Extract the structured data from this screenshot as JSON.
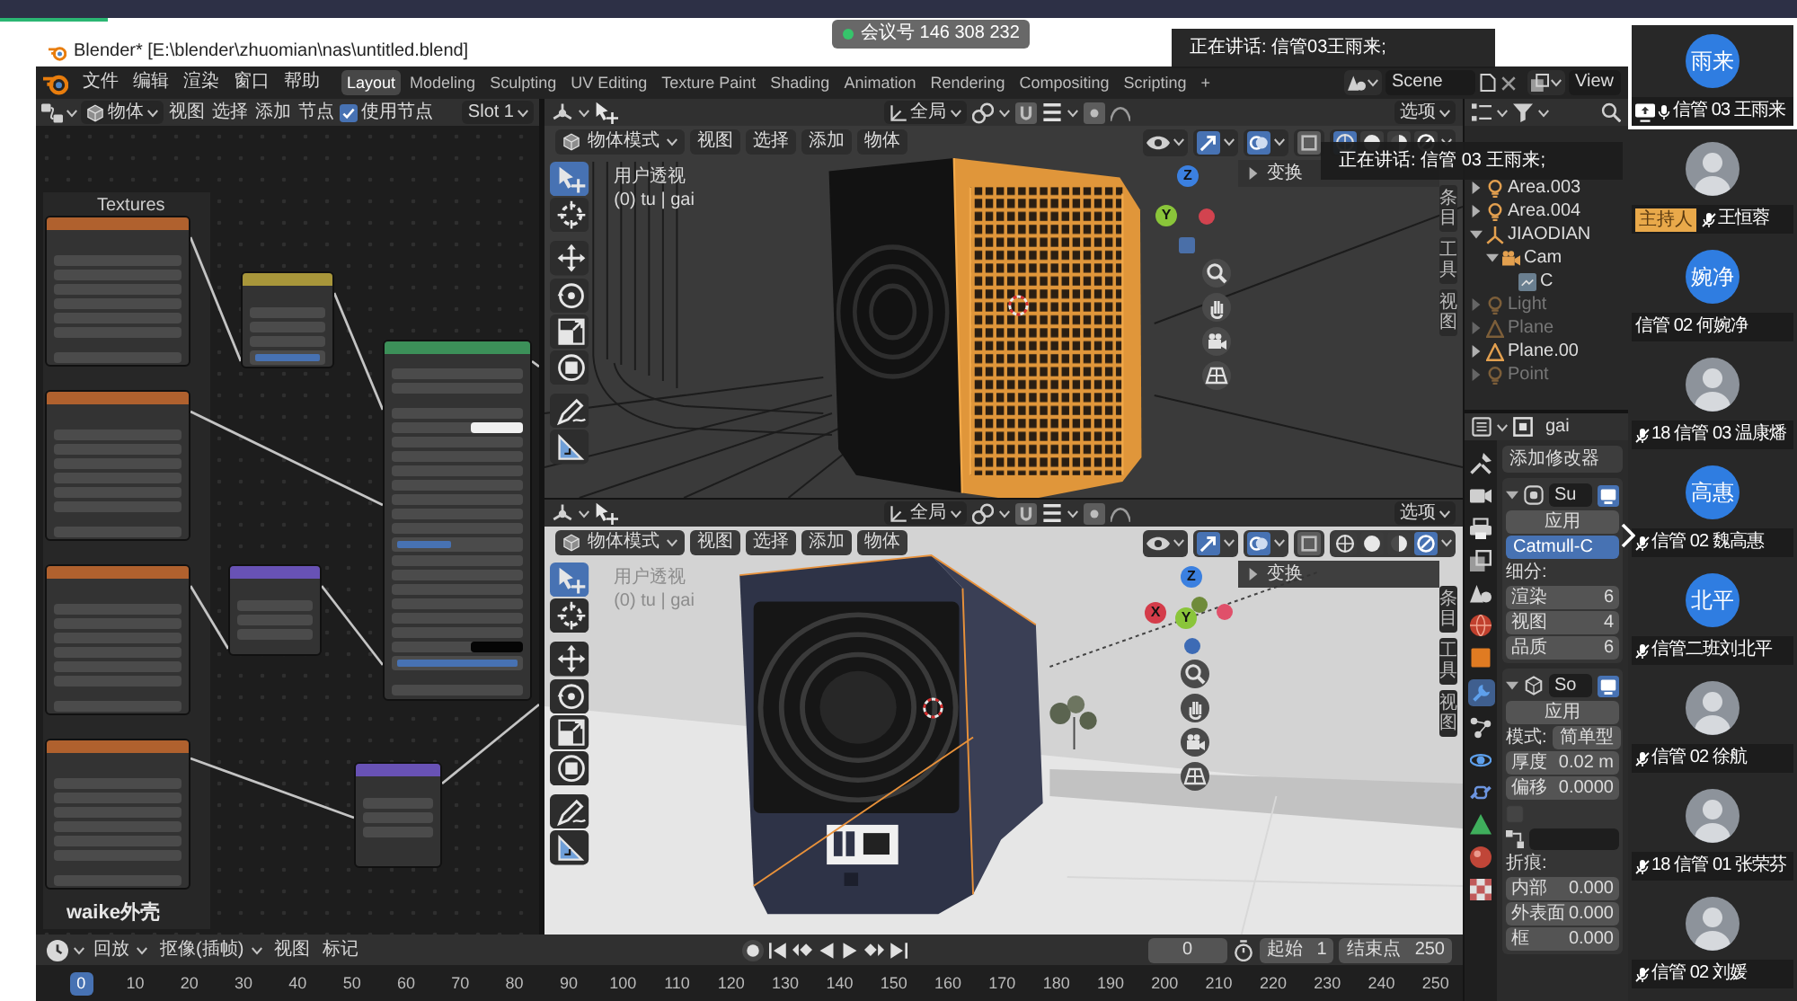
{
  "meeting": {
    "number": "会议号 146 308 232",
    "toasts": [
      {
        "text": "正在讲话: 信管03王雨来;"
      },
      {
        "text": "正在讲话: 信管 03 王雨来;"
      }
    ]
  },
  "window": {
    "title": "Blender* [E:\\blender\\zhuomian\\nas\\untitled.blend]"
  },
  "topbar": {
    "menus": [
      "文件",
      "编辑",
      "渲染",
      "窗口",
      "帮助"
    ],
    "workspaces": [
      {
        "label": "Layout",
        "selected": true
      },
      {
        "label": "Modeling",
        "selected": false
      },
      {
        "label": "Sculpting",
        "selected": false
      },
      {
        "label": "UV Editing",
        "selected": false
      },
      {
        "label": "Texture Paint",
        "selected": false
      },
      {
        "label": "Shading",
        "selected": false
      },
      {
        "label": "Animation",
        "selected": false
      },
      {
        "label": "Rendering",
        "selected": false
      },
      {
        "label": "Compositing",
        "selected": false
      },
      {
        "label": "Scripting",
        "selected": false
      }
    ],
    "add_workspace": "+",
    "scene": "Scene",
    "view_layer": "View"
  },
  "node_editor": {
    "object_menu": "物体",
    "menus": [
      "视图",
      "选择",
      "添加",
      "节点"
    ],
    "use_nodes": {
      "label": "使用节点",
      "checked": true
    },
    "slot": "Slot 1",
    "frame": {
      "label": "Textures",
      "footer": "waike外壳"
    },
    "nodes": [
      {
        "kind": "image",
        "color": "#b0612e"
      },
      {
        "kind": "image",
        "color": "#b0612e"
      },
      {
        "kind": "image",
        "color": "#b0612e"
      },
      {
        "kind": "image",
        "color": "#b0612e"
      },
      {
        "kind": "converter",
        "color": "#a8963a",
        "sliders": [
          {
            "level": 1
          }
        ]
      },
      {
        "kind": "bsdf",
        "color": "#3c9059",
        "sliders": [
          {
            "level": 0.45
          },
          {
            "level": 1
          }
        ],
        "swatches": [
          {
            "color": "#f0f0f0"
          },
          {
            "color": "#050505"
          }
        ]
      },
      {
        "kind": "vector",
        "color": "#6852b5"
      },
      {
        "kind": "vector",
        "color": "#6852b5"
      }
    ]
  },
  "viewports": [
    {
      "kind": "wireframe",
      "orientation": "全局",
      "options": "选项",
      "mode": "物体模式",
      "menus": [
        "视图",
        "选择",
        "添加",
        "物体"
      ],
      "view_name": "用户透视",
      "collection": "(0) tu | gai",
      "transform": "变换",
      "tools": [
        {
          "kind": "select",
          "selected": true
        },
        {
          "kind": "cursor",
          "selected": false
        },
        {
          "kind": "move",
          "selected": false
        },
        {
          "kind": "rotate",
          "selected": false
        },
        {
          "kind": "scale",
          "selected": false
        },
        {
          "kind": "transform",
          "selected": false
        },
        {
          "kind": "annotate",
          "selected": false
        },
        {
          "kind": "measure",
          "selected": false
        }
      ],
      "gizmo": [
        {
          "label": "Z",
          "color": "#3b80e0"
        },
        {
          "label": "Y",
          "color": "#8ac53a"
        }
      ],
      "side_tabs": [
        {
          "label": "条目"
        },
        {
          "label": "工具"
        },
        {
          "label": "视图"
        }
      ]
    },
    {
      "kind": "rendered",
      "orientation": "全局",
      "options": "选项",
      "mode": "物体模式",
      "menus": [
        "视图",
        "选择",
        "添加",
        "物体"
      ],
      "view_name": "用户透视",
      "collection": "(0) tu | gai",
      "transform": "变换",
      "tools": [
        {
          "kind": "select",
          "selected": true
        },
        {
          "kind": "cursor",
          "selected": false
        },
        {
          "kind": "move",
          "selected": false
        },
        {
          "kind": "rotate",
          "selected": false
        },
        {
          "kind": "scale",
          "selected": false
        },
        {
          "kind": "transform",
          "selected": false
        },
        {
          "kind": "annotate",
          "selected": false
        },
        {
          "kind": "measure",
          "selected": false
        }
      ],
      "gizmo": [
        {
          "label": "Z",
          "color": "#3b80e0"
        },
        {
          "label": "X",
          "color": "#d43c4a"
        },
        {
          "label": "Y",
          "color": "#8ac53a"
        }
      ],
      "side_tabs": [
        {
          "label": "条目"
        },
        {
          "label": "工具"
        },
        {
          "label": "视图"
        }
      ]
    }
  ],
  "outliner": {
    "items": [
      {
        "label": "Area.003",
        "kind": "light",
        "hidden": false,
        "expanded": false
      },
      {
        "label": "Area.004",
        "kind": "light",
        "hidden": false,
        "expanded": false
      },
      {
        "label": "JIAODIAN",
        "kind": "empty",
        "hidden": false,
        "expanded": true,
        "children": [
          {
            "label": "Cam",
            "kind": "camera",
            "hidden": false,
            "expanded": true,
            "children": [
              {
                "label": "C",
                "kind": "camera_data",
                "hidden": false
              }
            ]
          }
        ]
      },
      {
        "label": "Light",
        "kind": "light",
        "hidden": true,
        "expanded": false
      },
      {
        "label": "Plane",
        "kind": "mesh",
        "hidden": true,
        "expanded": false
      },
      {
        "label": "Plane.00",
        "kind": "mesh",
        "hidden": false,
        "expanded": false
      },
      {
        "label": "Point",
        "kind": "light",
        "hidden": true,
        "expanded": false
      }
    ]
  },
  "properties": {
    "object": "gai",
    "tabs": [
      {
        "kind": "tool",
        "selected": false
      },
      {
        "kind": "render",
        "selected": false
      },
      {
        "kind": "output",
        "selected": false
      },
      {
        "kind": "view_layer",
        "selected": false
      },
      {
        "kind": "scene",
        "selected": false
      },
      {
        "kind": "world",
        "selected": false
      },
      {
        "kind": "object",
        "selected": false
      },
      {
        "kind": "modifier",
        "selected": true
      },
      {
        "kind": "particles",
        "selected": false
      },
      {
        "kind": "physics",
        "selected": false
      },
      {
        "kind": "constraints",
        "selected": false
      },
      {
        "kind": "data",
        "selected": false
      },
      {
        "kind": "material",
        "selected": false
      },
      {
        "kind": "texture",
        "selected": false
      }
    ],
    "add_modifier": "添加修改器",
    "modifiers": [
      {
        "kind": "subsurf",
        "name": "Su",
        "expanded": true,
        "rows": [
          {
            "kind": "button",
            "label": "应用"
          },
          {
            "kind": "segmented",
            "label": "Catmull-C",
            "selected": true
          },
          {
            "kind": "heading",
            "label": "细分:"
          },
          {
            "kind": "field",
            "label": "渲染",
            "value": "6"
          },
          {
            "kind": "field",
            "label": "视图",
            "value": "4"
          },
          {
            "kind": "field",
            "label": "品质",
            "value": "6"
          }
        ]
      },
      {
        "kind": "solidify",
        "name": "So",
        "expanded": true,
        "rows": [
          {
            "kind": "button",
            "label": "应用"
          },
          {
            "kind": "dropdown",
            "label": "模式:",
            "value": "简单型"
          },
          {
            "kind": "field",
            "label": "厚度",
            "value": "0.02 m"
          },
          {
            "kind": "field",
            "label": "偏移",
            "value": "0.0000"
          },
          {
            "kind": "checkbox",
            "checked": false
          },
          {
            "kind": "vgroup"
          },
          {
            "kind": "heading",
            "label": "折痕:"
          },
          {
            "kind": "field",
            "label": "内部",
            "value": "0.000"
          },
          {
            "kind": "field",
            "label": "外表面",
            "value": "0.000"
          },
          {
            "kind": "field",
            "label": "框",
            "value": "0.000"
          }
        ]
      }
    ]
  },
  "timeline": {
    "menus": [
      "回放",
      "抠像(插帧)",
      "视图",
      "标记"
    ],
    "frame": "0",
    "start_label": "起始",
    "start": "1",
    "end_label": "结束点",
    "end": "250",
    "ruler": [
      {
        "label": "0",
        "selected": true
      },
      {
        "label": "10",
        "selected": false
      },
      {
        "label": "20",
        "selected": false
      },
      {
        "label": "30",
        "selected": false
      },
      {
        "label": "40",
        "selected": false
      },
      {
        "label": "50",
        "selected": false
      },
      {
        "label": "60",
        "selected": false
      },
      {
        "label": "70",
        "selected": false
      },
      {
        "label": "80",
        "selected": false
      },
      {
        "label": "90",
        "selected": false
      },
      {
        "label": "100",
        "selected": false
      },
      {
        "label": "110",
        "selected": false
      },
      {
        "label": "120",
        "selected": false
      },
      {
        "label": "130",
        "selected": false
      },
      {
        "label": "140",
        "selected": false
      },
      {
        "label": "150",
        "selected": false
      },
      {
        "label": "160",
        "selected": false
      },
      {
        "label": "170",
        "selected": false
      },
      {
        "label": "180",
        "selected": false
      },
      {
        "label": "190",
        "selected": false
      },
      {
        "label": "200",
        "selected": false
      },
      {
        "label": "210",
        "selected": false
      },
      {
        "label": "220",
        "selected": false
      },
      {
        "label": "230",
        "selected": false
      },
      {
        "label": "240",
        "selected": false
      },
      {
        "label": "250",
        "selected": false
      }
    ]
  },
  "participants": [
    {
      "name": "信管 03 王雨来",
      "avatar": {
        "kind": "initials",
        "text": "雨来"
      },
      "sharing": true,
      "mic": true,
      "muted": false,
      "active": true
    },
    {
      "name": "王恒蓉",
      "avatar": {
        "kind": "photo"
      },
      "badge": "主持人",
      "sharing": false,
      "mic": true,
      "muted": true,
      "active": false
    },
    {
      "name": "信管 02 何婉净",
      "avatar": {
        "kind": "initials",
        "text": "婉净"
      },
      "sharing": false,
      "mic": false,
      "active": false
    },
    {
      "name": "18 信管 03 温康燔",
      "avatar": {
        "kind": "photo"
      },
      "sharing": false,
      "mic": true,
      "muted": true,
      "active": false
    },
    {
      "name": "信管 02 魏高惠",
      "avatar": {
        "kind": "initials",
        "text": "高惠"
      },
      "sharing": false,
      "mic": true,
      "muted": true,
      "active": false
    },
    {
      "name": "信管二班刘北平",
      "avatar": {
        "kind": "initials",
        "text": "北平"
      },
      "sharing": false,
      "mic": true,
      "muted": true,
      "active": false
    },
    {
      "name": "信管 02 徐航",
      "avatar": {
        "kind": "photo"
      },
      "sharing": false,
      "mic": true,
      "muted": true,
      "active": false
    },
    {
      "name": "18 信管 01 张荣芬",
      "avatar": {
        "kind": "photo"
      },
      "sharing": false,
      "mic": true,
      "muted": true,
      "active": false
    },
    {
      "name": "信管 02 刘媛",
      "avatar": {
        "kind": "photo"
      },
      "sharing": false,
      "mic": true,
      "muted": true,
      "active": false
    }
  ]
}
